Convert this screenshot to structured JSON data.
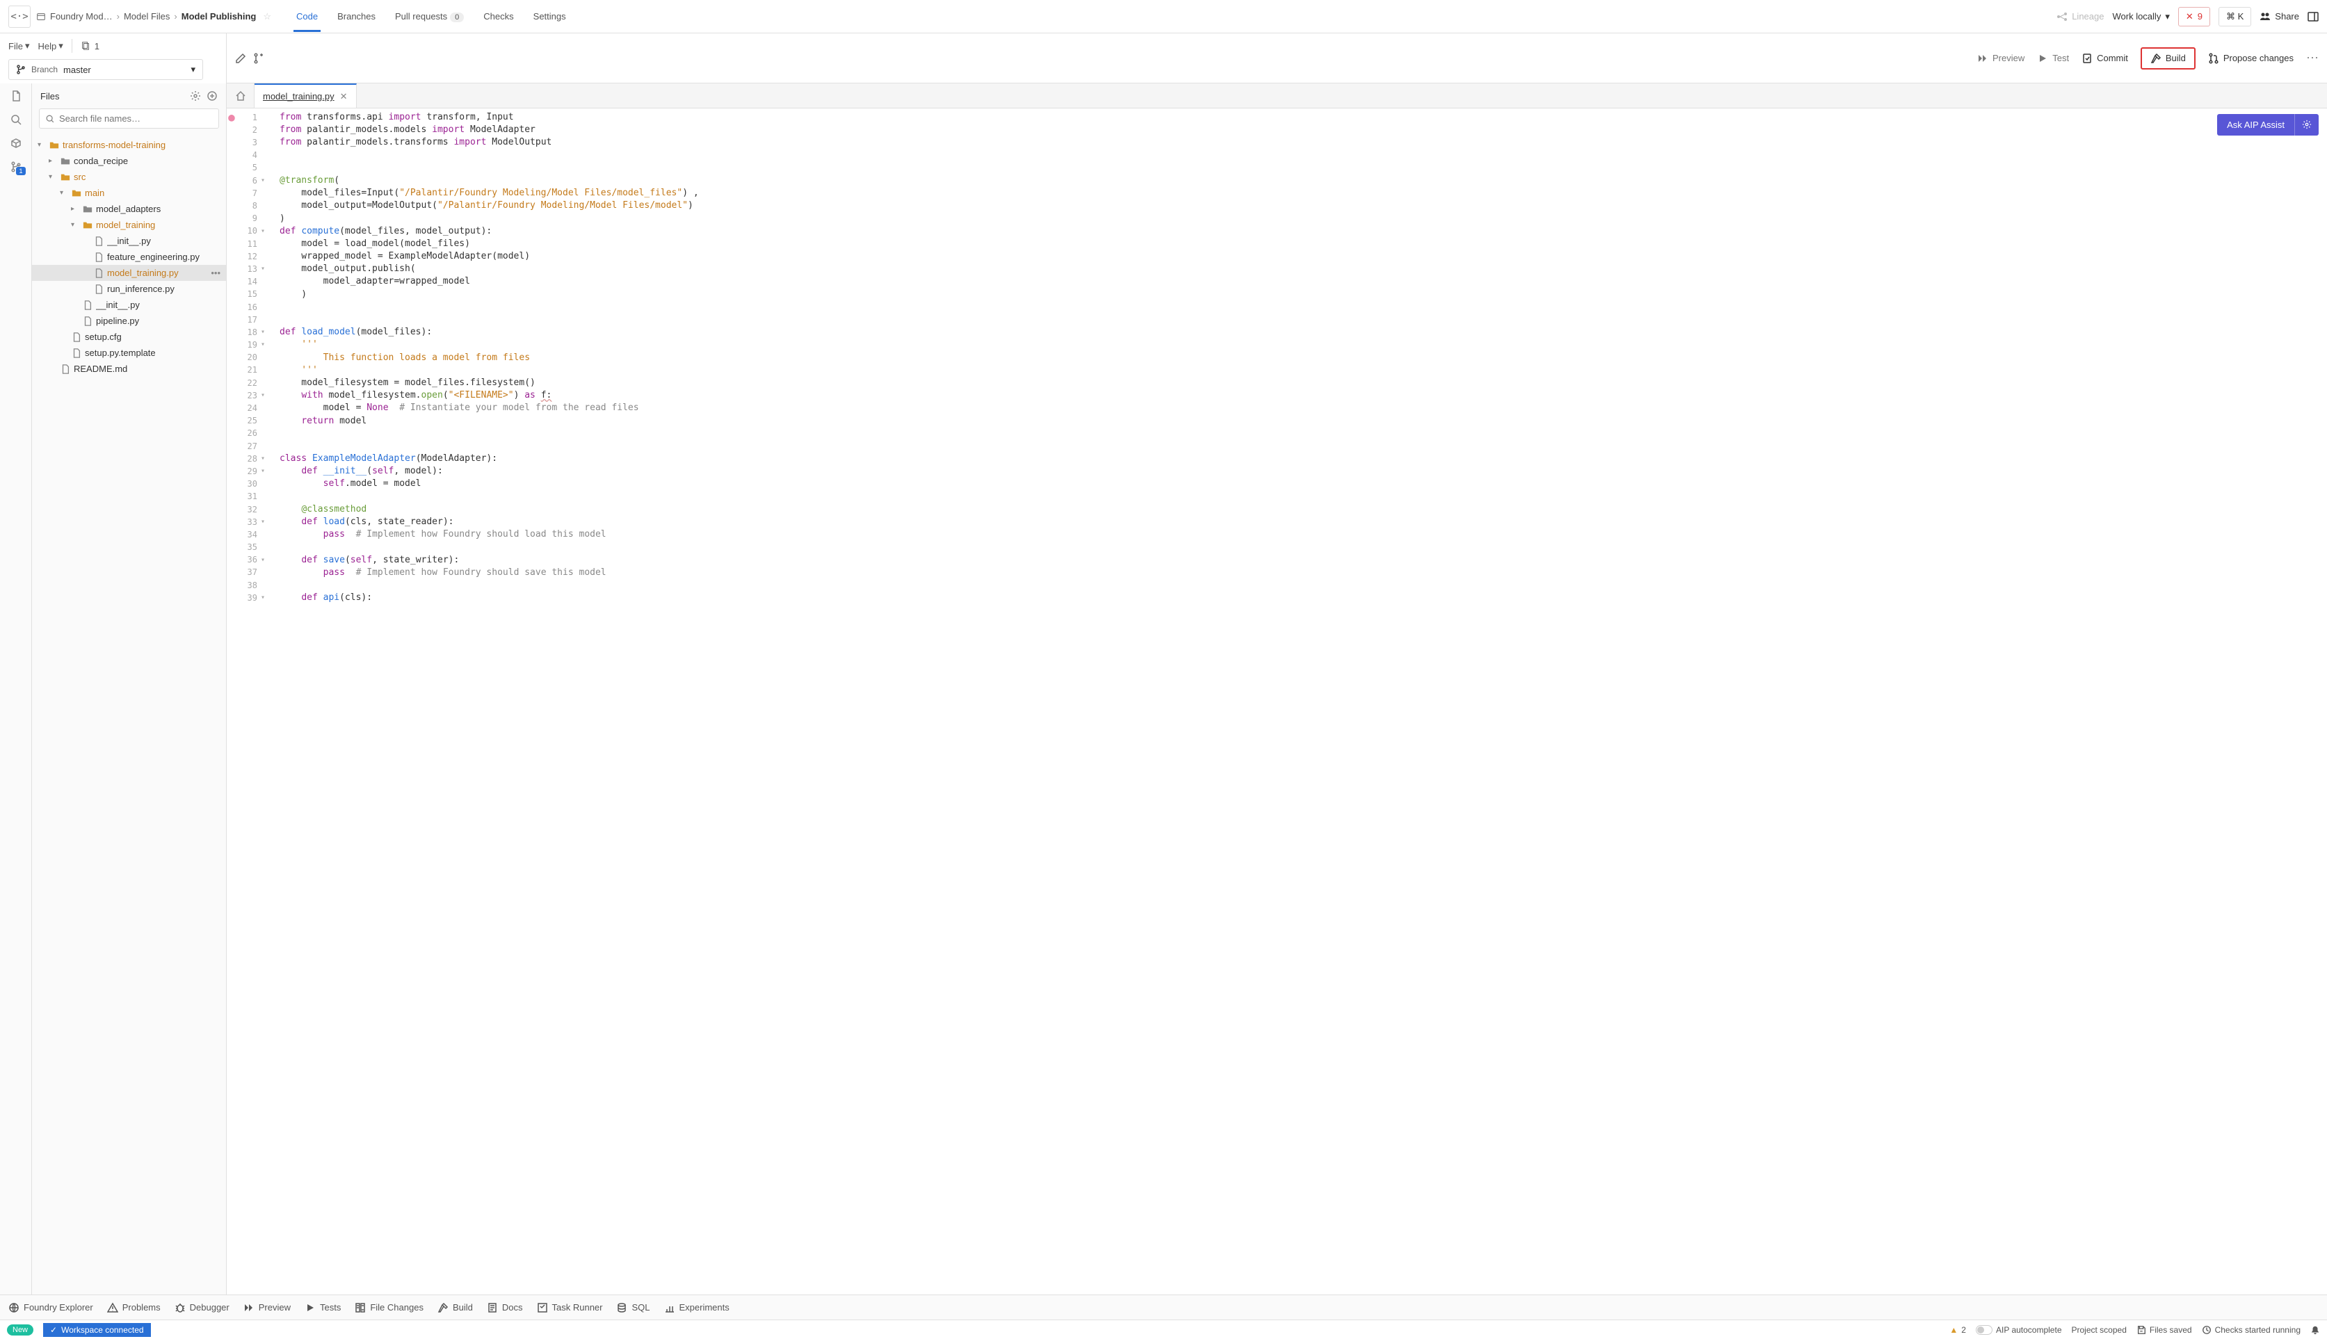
{
  "header": {
    "breadcrumb": [
      "Foundry Mod…",
      "Model Files",
      "Model Publishing"
    ],
    "tabs": [
      {
        "label": "Code",
        "active": true
      },
      {
        "label": "Branches"
      },
      {
        "label": "Pull requests",
        "badge": "0"
      },
      {
        "label": "Checks"
      },
      {
        "label": "Settings"
      }
    ],
    "lineage": "Lineage",
    "work_locally": "Work locally",
    "error_count": "9",
    "cmd_k": "⌘ K",
    "share": "Share"
  },
  "menus": {
    "file": "File",
    "help": "Help",
    "files_count": "1"
  },
  "branch": {
    "label": "Branch",
    "name": "master"
  },
  "toolbar": {
    "preview": "Preview",
    "test": "Test",
    "commit": "Commit",
    "build": "Build",
    "propose": "Propose changes"
  },
  "files_panel": {
    "title": "Files",
    "search_placeholder": "Search file names…"
  },
  "file_tree": [
    {
      "depth": 0,
      "type": "folder-open",
      "name": "transforms-model-training",
      "chev": "▾",
      "orange": true
    },
    {
      "depth": 1,
      "type": "folder-closed",
      "name": "conda_recipe",
      "chev": "▸"
    },
    {
      "depth": 1,
      "type": "folder-open",
      "name": "src",
      "chev": "▾",
      "orange": true
    },
    {
      "depth": 2,
      "type": "folder-open",
      "name": "main",
      "chev": "▾",
      "orange": true
    },
    {
      "depth": 3,
      "type": "folder-closed",
      "name": "model_adapters",
      "chev": "▸"
    },
    {
      "depth": 3,
      "type": "folder-open",
      "name": "model_training",
      "chev": "▾",
      "orange": true
    },
    {
      "depth": 4,
      "type": "file",
      "name": "__init__.py"
    },
    {
      "depth": 4,
      "type": "file",
      "name": "feature_engineering.py"
    },
    {
      "depth": 4,
      "type": "file",
      "name": "model_training.py",
      "selected": true,
      "orange": true,
      "more": true
    },
    {
      "depth": 4,
      "type": "file",
      "name": "run_inference.py"
    },
    {
      "depth": 3,
      "type": "file",
      "name": "__init__.py"
    },
    {
      "depth": 3,
      "type": "file",
      "name": "pipeline.py"
    },
    {
      "depth": 2,
      "type": "file",
      "name": "setup.cfg"
    },
    {
      "depth": 2,
      "type": "file",
      "name": "setup.py.template"
    },
    {
      "depth": 1,
      "type": "file",
      "name": "README.md"
    }
  ],
  "editor": {
    "tab_name": "model_training.py",
    "aip_button": "Ask AIP Assist"
  },
  "code_lines": [
    {
      "n": 1,
      "mark": "●",
      "tokens": [
        [
          "kw",
          "from"
        ],
        [
          "",
          " transforms.api "
        ],
        [
          "kw",
          "import"
        ],
        [
          "",
          " transform, Input"
        ]
      ]
    },
    {
      "n": 2,
      "tokens": [
        [
          "kw",
          "from"
        ],
        [
          "",
          " palantir_models.models "
        ],
        [
          "kw",
          "import"
        ],
        [
          "",
          " ModelAdapter"
        ]
      ]
    },
    {
      "n": 3,
      "tokens": [
        [
          "kw",
          "from"
        ],
        [
          "",
          " palantir_models.transforms "
        ],
        [
          "kw",
          "import"
        ],
        [
          "",
          " ModelOutput"
        ]
      ]
    },
    {
      "n": 4,
      "tokens": []
    },
    {
      "n": 5,
      "tokens": []
    },
    {
      "n": 6,
      "fold": "▾",
      "tokens": [
        [
          "dec",
          "@transform"
        ],
        [
          "",
          "("
        ]
      ]
    },
    {
      "n": 7,
      "tokens": [
        [
          "",
          "    model_files=Input("
        ],
        [
          "str",
          "\"/Palantir/Foundry Modeling/Model Files/model_files\""
        ],
        [
          "",
          ")"
        ],
        [
          "",
          " ,"
        ]
      ]
    },
    {
      "n": 8,
      "tokens": [
        [
          "",
          "    model_output=ModelOutput("
        ],
        [
          "str",
          "\"/Palantir/Foundry Modeling/Model Files/model\""
        ],
        [
          "",
          ")"
        ]
      ]
    },
    {
      "n": 9,
      "tokens": [
        [
          "",
          ")"
        ]
      ]
    },
    {
      "n": 10,
      "fold": "▾",
      "tokens": [
        [
          "kw",
          "def"
        ],
        [
          "",
          " "
        ],
        [
          "fn",
          "compute"
        ],
        [
          "",
          "(model_files, model_output):"
        ]
      ]
    },
    {
      "n": 11,
      "tokens": [
        [
          "",
          "    model = load_model(model_files)"
        ]
      ]
    },
    {
      "n": 12,
      "tokens": [
        [
          "",
          "    wrapped_model = ExampleModelAdapter(model)"
        ]
      ]
    },
    {
      "n": 13,
      "fold": "▾",
      "tokens": [
        [
          "",
          "    model_output.publish("
        ]
      ]
    },
    {
      "n": 14,
      "tokens": [
        [
          "",
          "        model_adapter=wrapped_model"
        ]
      ]
    },
    {
      "n": 15,
      "tokens": [
        [
          "",
          "    )"
        ]
      ]
    },
    {
      "n": 16,
      "tokens": []
    },
    {
      "n": 17,
      "tokens": []
    },
    {
      "n": 18,
      "fold": "▾",
      "tokens": [
        [
          "kw",
          "def"
        ],
        [
          "",
          " "
        ],
        [
          "fn",
          "load_model"
        ],
        [
          "",
          "(model_files):"
        ]
      ]
    },
    {
      "n": 19,
      "fold": "▾",
      "tokens": [
        [
          "str",
          "    '''"
        ]
      ]
    },
    {
      "n": 20,
      "tokens": [
        [
          "str",
          "        This function loads a model from files"
        ]
      ]
    },
    {
      "n": 21,
      "tokens": [
        [
          "str",
          "    '''"
        ]
      ]
    },
    {
      "n": 22,
      "tokens": [
        [
          "",
          "    model_filesystem = model_files.filesystem()"
        ]
      ]
    },
    {
      "n": 23,
      "fold": "▾",
      "tokens": [
        [
          "",
          "    "
        ],
        [
          "kw",
          "with"
        ],
        [
          "",
          " model_filesystem."
        ],
        [
          "builtin",
          "open"
        ],
        [
          "",
          "("
        ],
        [
          "str",
          "\"<FILENAME>\""
        ],
        [
          "",
          ") "
        ],
        [
          "kw",
          "as"
        ],
        [
          "",
          " "
        ],
        [
          "und",
          "f:"
        ]
      ]
    },
    {
      "n": 24,
      "tokens": [
        [
          "",
          "        model = "
        ],
        [
          "none",
          "None"
        ],
        [
          "",
          "  "
        ],
        [
          "com",
          "# Instantiate your model from the read files"
        ]
      ]
    },
    {
      "n": 25,
      "tokens": [
        [
          "",
          "    "
        ],
        [
          "kw",
          "return"
        ],
        [
          "",
          " model"
        ]
      ]
    },
    {
      "n": 26,
      "tokens": []
    },
    {
      "n": 27,
      "tokens": []
    },
    {
      "n": 28,
      "fold": "▾",
      "tokens": [
        [
          "kw",
          "class"
        ],
        [
          "",
          " "
        ],
        [
          "cls",
          "ExampleModelAdapter"
        ],
        [
          "",
          "(ModelAdapter):"
        ]
      ]
    },
    {
      "n": 29,
      "fold": "▾",
      "tokens": [
        [
          "",
          "    "
        ],
        [
          "kw",
          "def"
        ],
        [
          "",
          " "
        ],
        [
          "fn",
          "__init__"
        ],
        [
          "",
          "("
        ],
        [
          "self",
          "self"
        ],
        [
          "",
          ", model):"
        ]
      ]
    },
    {
      "n": 30,
      "tokens": [
        [
          "",
          "        "
        ],
        [
          "self",
          "self"
        ],
        [
          "",
          ".model = model"
        ]
      ]
    },
    {
      "n": 31,
      "tokens": []
    },
    {
      "n": 32,
      "tokens": [
        [
          "",
          "    "
        ],
        [
          "dec",
          "@classmethod"
        ]
      ]
    },
    {
      "n": 33,
      "fold": "▾",
      "tokens": [
        [
          "",
          "    "
        ],
        [
          "kw",
          "def"
        ],
        [
          "",
          " "
        ],
        [
          "fn",
          "load"
        ],
        [
          "",
          "(cls, state_reader):"
        ]
      ]
    },
    {
      "n": 34,
      "tokens": [
        [
          "",
          "        "
        ],
        [
          "kw",
          "pass"
        ],
        [
          "",
          "  "
        ],
        [
          "com",
          "# Implement how Foundry should load this model"
        ]
      ]
    },
    {
      "n": 35,
      "tokens": []
    },
    {
      "n": 36,
      "fold": "▾",
      "tokens": [
        [
          "",
          "    "
        ],
        [
          "kw",
          "def"
        ],
        [
          "",
          " "
        ],
        [
          "fn",
          "save"
        ],
        [
          "",
          "("
        ],
        [
          "self",
          "self"
        ],
        [
          "",
          ", state_writer):"
        ]
      ]
    },
    {
      "n": 37,
      "tokens": [
        [
          "",
          "        "
        ],
        [
          "kw",
          "pass"
        ],
        [
          "",
          "  "
        ],
        [
          "com",
          "# Implement how Foundry should save this model"
        ]
      ]
    },
    {
      "n": 38,
      "tokens": []
    },
    {
      "n": 39,
      "fold": "▾",
      "tokens": [
        [
          "",
          "    "
        ],
        [
          "kw",
          "def"
        ],
        [
          "",
          " "
        ],
        [
          "fn",
          "api"
        ],
        [
          "",
          "(cls):"
        ]
      ]
    }
  ],
  "bottom_toolbar": [
    {
      "icon": "globe",
      "label": "Foundry Explorer"
    },
    {
      "icon": "warn",
      "label": "Problems"
    },
    {
      "icon": "bug",
      "label": "Debugger"
    },
    {
      "icon": "fwd",
      "label": "Preview"
    },
    {
      "icon": "play",
      "label": "Tests"
    },
    {
      "icon": "diff",
      "label": "File Changes"
    },
    {
      "icon": "hammer",
      "label": "Build"
    },
    {
      "icon": "doc",
      "label": "Docs"
    },
    {
      "icon": "task",
      "label": "Task Runner"
    },
    {
      "icon": "db",
      "label": "SQL"
    },
    {
      "icon": "chart",
      "label": "Experiments"
    }
  ],
  "status_bar": {
    "new_label": "New",
    "connected": "Workspace connected",
    "warning_count": "2",
    "aip_auto": "AIP autocomplete",
    "scoped": "Project scoped",
    "saved": "Files saved",
    "checks": "Checks started running"
  }
}
